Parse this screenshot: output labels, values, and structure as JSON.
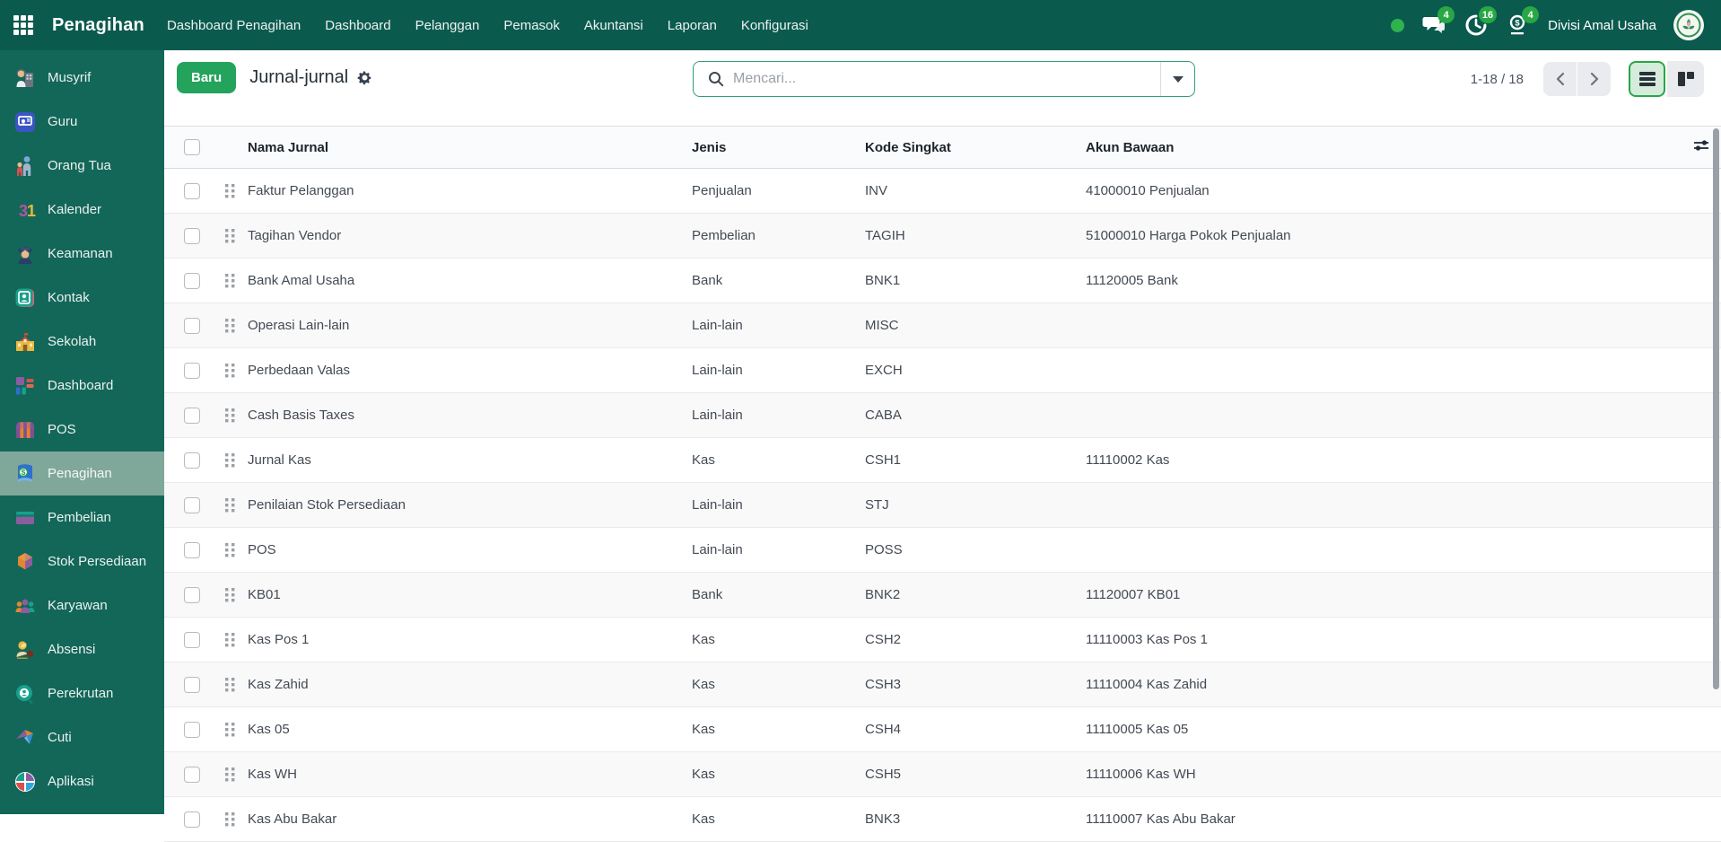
{
  "topnav": {
    "brand": "Penagihan",
    "menu_items": [
      {
        "label": "Dashboard Penagihan"
      },
      {
        "label": "Dashboard"
      },
      {
        "label": "Pelanggan"
      },
      {
        "label": "Pemasok"
      },
      {
        "label": "Akuntansi"
      },
      {
        "label": "Laporan"
      },
      {
        "label": "Konfigurasi"
      }
    ],
    "badges": {
      "messages": "4",
      "activities": "16",
      "money": "4"
    },
    "company": "Divisi Amal Usaha"
  },
  "sidebar": {
    "items": [
      {
        "id": "musyrif",
        "label": "Musyrif",
        "icon": "musyrif",
        "active": false
      },
      {
        "id": "guru",
        "label": "Guru",
        "icon": "guru",
        "active": false
      },
      {
        "id": "orang-tua",
        "label": "Orang Tua",
        "icon": "orang-tua",
        "active": false
      },
      {
        "id": "kalender",
        "label": "Kalender",
        "icon": "kalender",
        "active": false
      },
      {
        "id": "keamanan",
        "label": "Keamanan",
        "icon": "keamanan",
        "active": false
      },
      {
        "id": "kontak",
        "label": "Kontak",
        "icon": "kontak",
        "active": false
      },
      {
        "id": "sekolah",
        "label": "Sekolah",
        "icon": "sekolah",
        "active": false
      },
      {
        "id": "dashboard",
        "label": "Dashboard",
        "icon": "dashboard",
        "active": false
      },
      {
        "id": "pos",
        "label": "POS",
        "icon": "pos",
        "active": false
      },
      {
        "id": "penagihan",
        "label": "Penagihan",
        "icon": "penagihan",
        "active": true
      },
      {
        "id": "pembelian",
        "label": "Pembelian",
        "icon": "pembelian",
        "active": false
      },
      {
        "id": "stok-persediaan",
        "label": "Stok Persediaan",
        "icon": "stok",
        "active": false
      },
      {
        "id": "karyawan",
        "label": "Karyawan",
        "icon": "karyawan",
        "active": false
      },
      {
        "id": "absensi",
        "label": "Absensi",
        "icon": "absensi",
        "active": false
      },
      {
        "id": "perekrutan",
        "label": "Perekrutan",
        "icon": "perekrutan",
        "active": false
      },
      {
        "id": "cuti",
        "label": "Cuti",
        "icon": "cuti",
        "active": false
      },
      {
        "id": "aplikasi",
        "label": "Aplikasi",
        "icon": "aplikasi",
        "active": false
      },
      {
        "id": "partial",
        "label": "",
        "icon": "partial",
        "active": false
      }
    ]
  },
  "control_panel": {
    "new_button": "Baru",
    "title": "Jurnal-jurnal",
    "search_placeholder": "Mencari...",
    "pager_range": "1-18 / 18"
  },
  "table": {
    "columns": {
      "name": "Nama Jurnal",
      "jenis": "Jenis",
      "kode": "Kode Singkat",
      "akun": "Akun Bawaan"
    },
    "rows": [
      {
        "name": "Faktur Pelanggan",
        "jenis": "Penjualan",
        "kode": "INV",
        "akun": "41000010 Penjualan"
      },
      {
        "name": "Tagihan Vendor",
        "jenis": "Pembelian",
        "kode": "TAGIH",
        "akun": "51000010 Harga Pokok Penjualan"
      },
      {
        "name": "Bank Amal Usaha",
        "jenis": "Bank",
        "kode": "BNK1",
        "akun": "11120005 Bank"
      },
      {
        "name": "Operasi Lain-lain",
        "jenis": "Lain-lain",
        "kode": "MISC",
        "akun": ""
      },
      {
        "name": "Perbedaan Valas",
        "jenis": "Lain-lain",
        "kode": "EXCH",
        "akun": ""
      },
      {
        "name": "Cash Basis Taxes",
        "jenis": "Lain-lain",
        "kode": "CABA",
        "akun": ""
      },
      {
        "name": "Jurnal Kas",
        "jenis": "Kas",
        "kode": "CSH1",
        "akun": "11110002 Kas"
      },
      {
        "name": "Penilaian Stok Persediaan",
        "jenis": "Lain-lain",
        "kode": "STJ",
        "akun": ""
      },
      {
        "name": "POS",
        "jenis": "Lain-lain",
        "kode": "POSS",
        "akun": ""
      },
      {
        "name": "KB01",
        "jenis": "Bank",
        "kode": "BNK2",
        "akun": "11120007 KB01"
      },
      {
        "name": "Kas Pos 1",
        "jenis": "Kas",
        "kode": "CSH2",
        "akun": "11110003 Kas Pos 1"
      },
      {
        "name": "Kas Zahid",
        "jenis": "Kas",
        "kode": "CSH3",
        "akun": "11110004 Kas Zahid"
      },
      {
        "name": "Kas 05",
        "jenis": "Kas",
        "kode": "CSH4",
        "akun": "11110005 Kas 05"
      },
      {
        "name": "Kas WH",
        "jenis": "Kas",
        "kode": "CSH5",
        "akun": "11110006 Kas WH"
      },
      {
        "name": "Kas Abu Bakar",
        "jenis": "Kas",
        "kode": "BNK3",
        "akun": "11110007 Kas Abu Bakar"
      }
    ]
  },
  "colors": {
    "topnav_bg": "#0b5a4e",
    "sidebar_bg": "#136758",
    "sidebar_active_bg": "#7fa89b",
    "primary_green": "#28a745",
    "new_button_green": "#23a35c",
    "search_border_green": "#2f9e77",
    "badge_green": "#28a745"
  }
}
